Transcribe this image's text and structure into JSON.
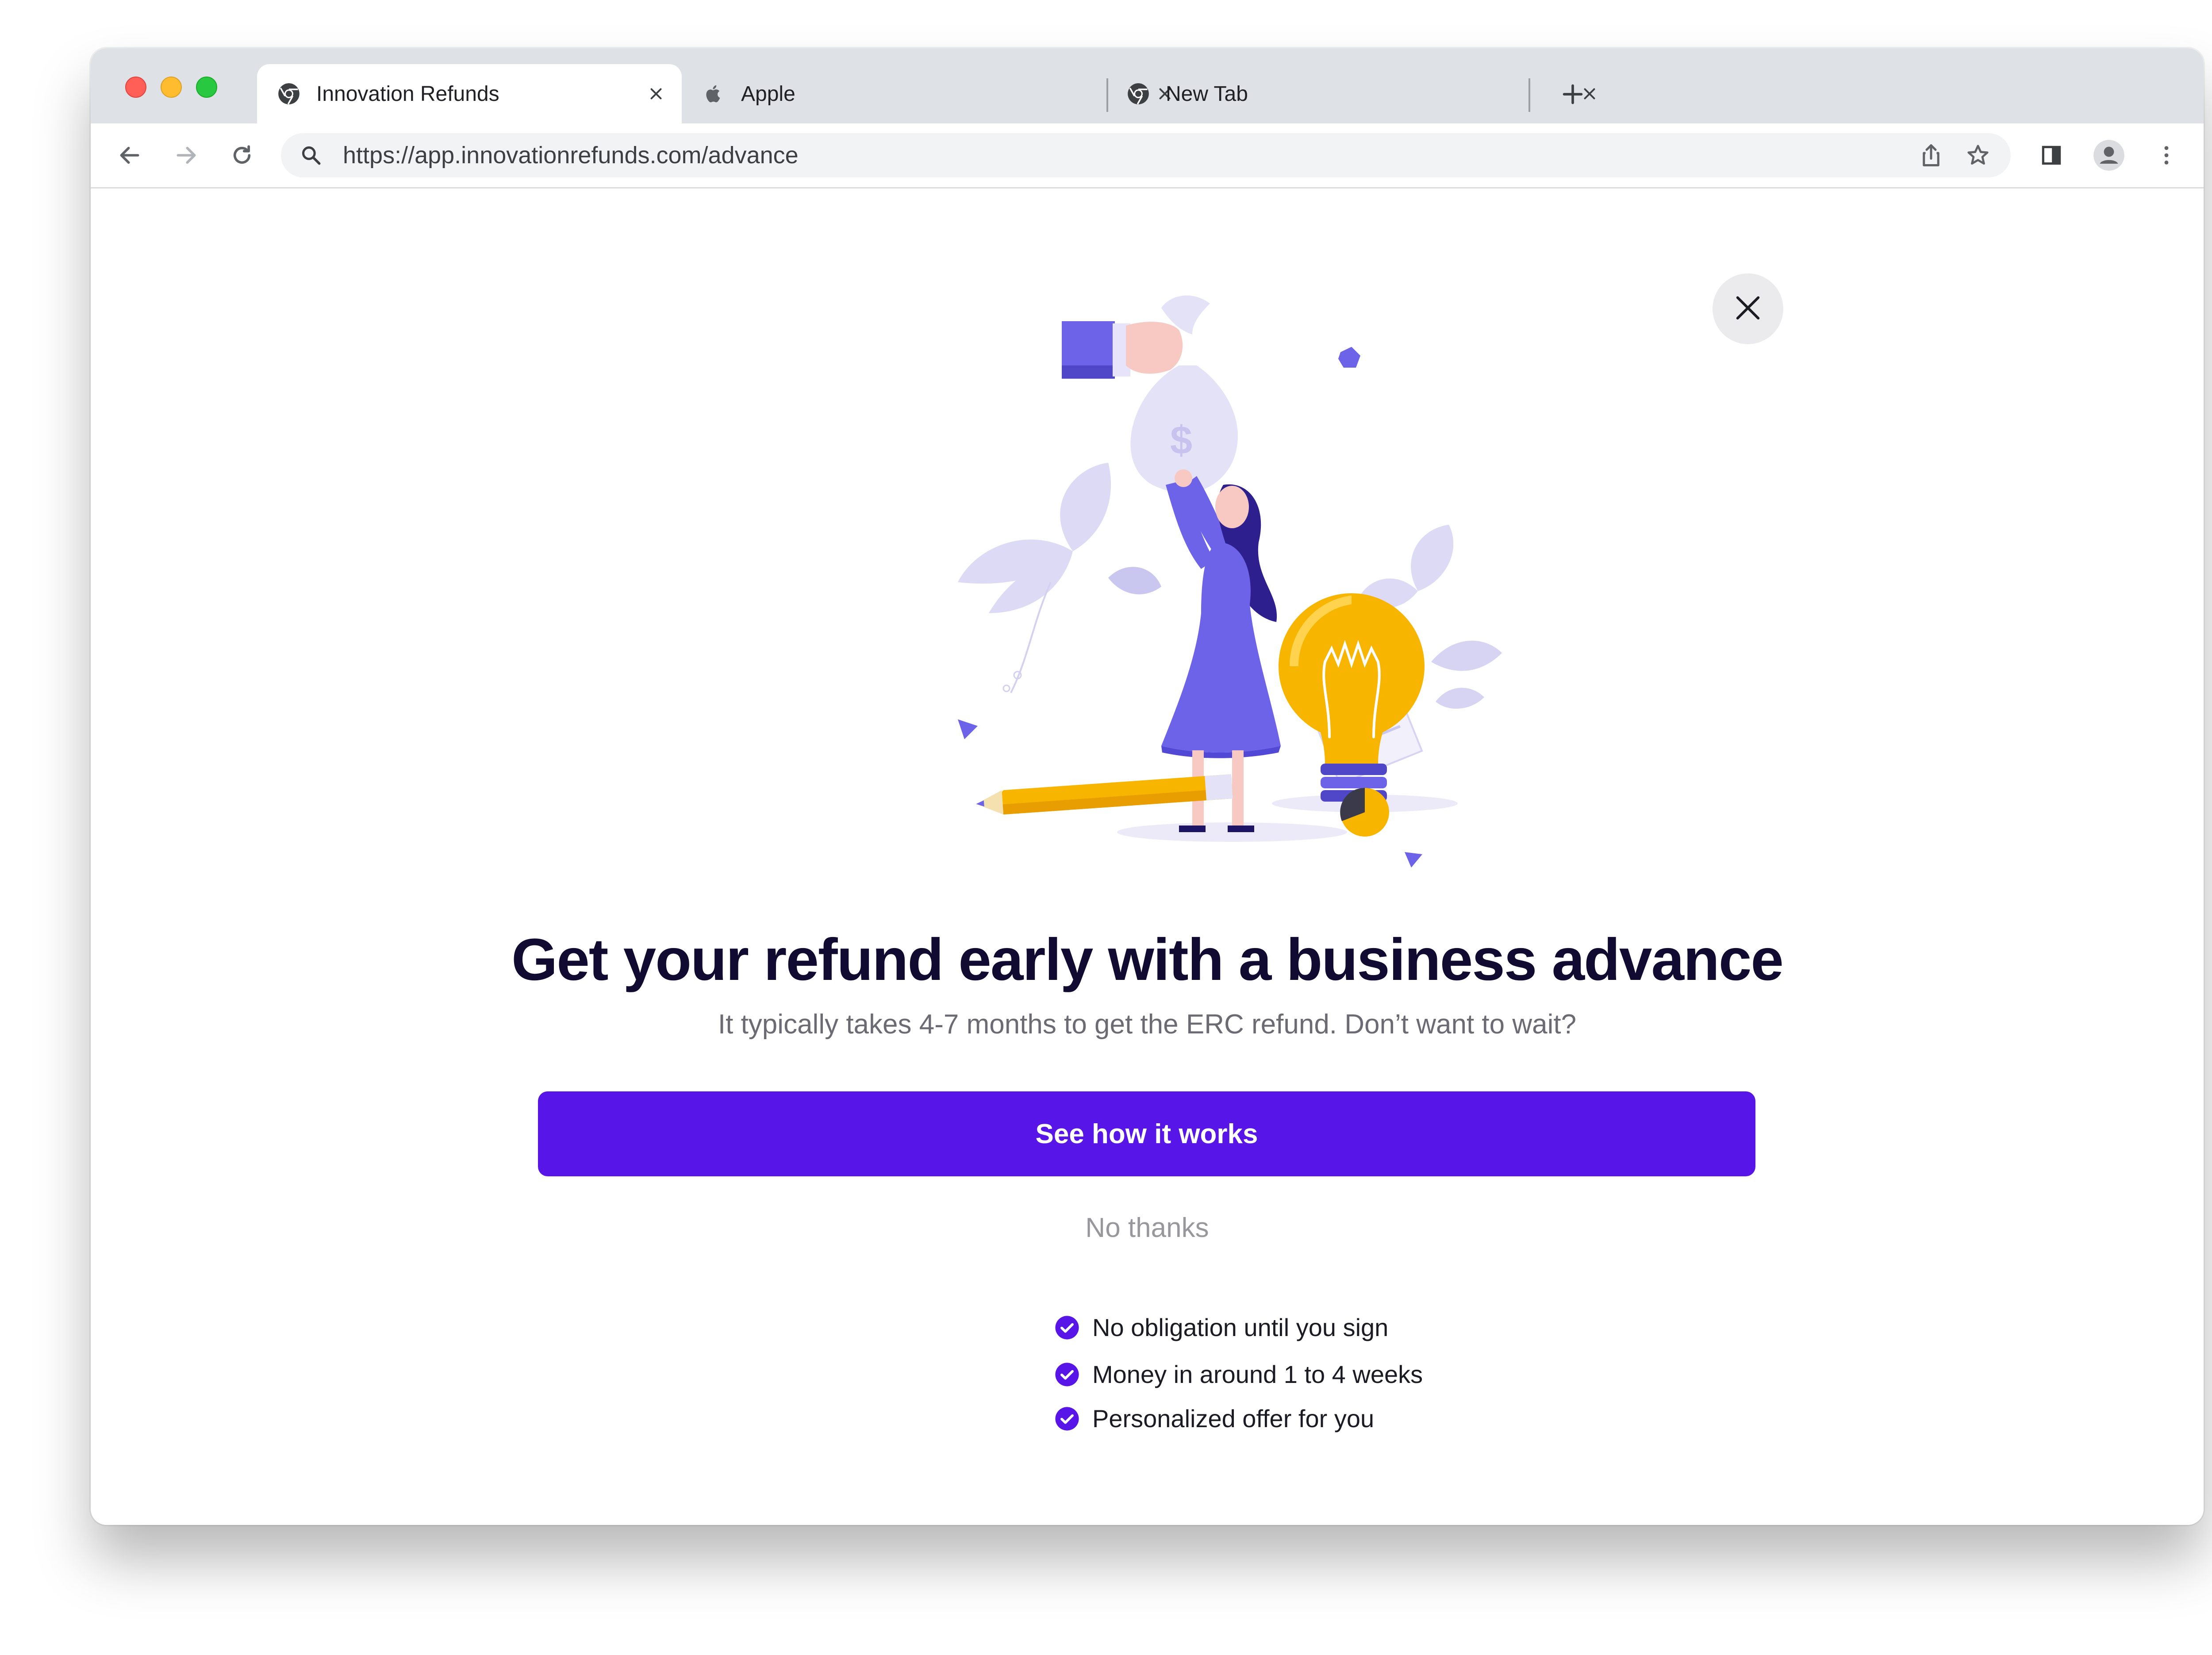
{
  "browser": {
    "tabs": [
      {
        "title": "Innovation Refunds",
        "favicon": "chrome-icon",
        "active": true
      },
      {
        "title": "Apple",
        "favicon": "apple-icon",
        "active": false
      },
      {
        "title": "New Tab",
        "favicon": "chrome-icon",
        "active": false
      }
    ],
    "url": "https://app.innovationrefunds.com/advance"
  },
  "modal": {
    "headline": "Get your refund early with a business advance",
    "subheadline": "It typically takes 4-7 months to get the ERC refund. Don’t want to wait?",
    "primary_button": "See how it works",
    "secondary_link": "No thanks",
    "benefits": [
      "No obligation until you sign",
      "Money in around 1 to 4 weeks",
      "Personalized offer for you"
    ]
  },
  "colors": {
    "accent": "#5715e8",
    "headline": "#120b31",
    "illustration_purple": "#6c63e8",
    "illustration_yellow": "#f7b500"
  }
}
